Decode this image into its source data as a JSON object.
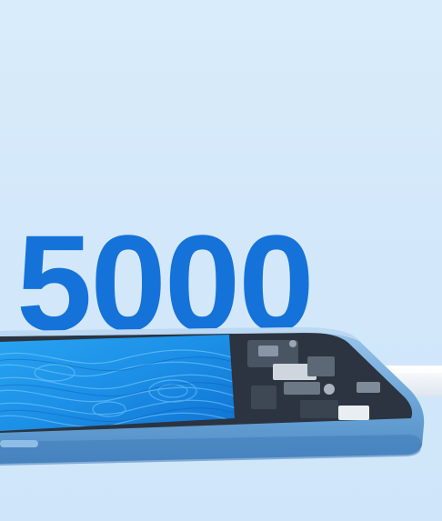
{
  "headline": {
    "text": "5000",
    "color": "#1572d9"
  },
  "colors": {
    "background": "#d6eafb",
    "phone_frame": "#6fa7d8",
    "screen_blue": "#1c8fe6",
    "cable": "#f4f7fb"
  },
  "scene": {
    "subject": "phone-cutaway-illustration",
    "icons": [
      "charging-cable-icon",
      "side-button-icon"
    ]
  }
}
